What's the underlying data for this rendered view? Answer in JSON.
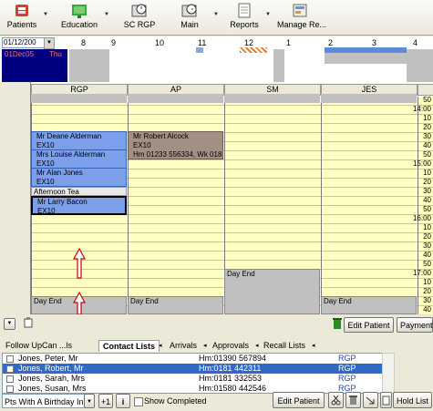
{
  "toolbar": {
    "patients": "Patients",
    "education": "Education",
    "sc_rgp": "SC RGP",
    "main": "Main",
    "reports": "Reports",
    "manage": "Manage Re..."
  },
  "strip": {
    "date": "01/12/200",
    "day_date": "01Dec05",
    "day_name": "Thu",
    "hours": [
      "8",
      "9",
      "10",
      "11",
      "12",
      "1",
      "2",
      "3",
      "4"
    ]
  },
  "schedule": {
    "times": [
      "50",
      "14:00",
      "10",
      "20",
      "30",
      "40",
      "50",
      "15:00",
      "10",
      "20",
      "30",
      "40",
      "50",
      "16:00",
      "10",
      "20",
      "30",
      "40",
      "50",
      "17:00",
      "10",
      "20",
      "30",
      "40"
    ],
    "columns": [
      "RGP",
      "AP",
      "SM",
      "JES"
    ],
    "appointments": {
      "a1_name": "Mr Deane Alderman",
      "a1_code": "EX10",
      "a2_name": "Mrs Louise Alderman",
      "a2_code": "EX10",
      "a3_name": "Mr Alan Jones",
      "a3_code": "EX10",
      "tea": "Afternoon Tea",
      "a4_name": "Mr Larry Bacon",
      "a4_code": "EX10",
      "b1_name": "Mr Robert Alcock",
      "b1_code": "EX10",
      "b1_phone": "Hm 01233 556334, Wk 018",
      "day_end": "Day End"
    }
  },
  "bottom": {
    "edit_patient": "Edit Patient",
    "payment": "Payment",
    "tabs": [
      "Follow Up",
      "Can ...ls",
      "Contact Lists",
      "Arrivals",
      "Approvals",
      "Recall Lists"
    ],
    "rows": [
      {
        "name": "Jones, Peter, Mr",
        "phone": "Hm:01390 567894",
        "dr": "RGP"
      },
      {
        "name": "Jones, Robert, Mr",
        "phone": "Hm:0181 442311",
        "dr": "RGP"
      },
      {
        "name": "Jones, Sarah, Mrs",
        "phone": "Hm:0181 332553",
        "dr": "RGP"
      },
      {
        "name": "Jones, Susan, Mrs",
        "phone": "Hm:01580 442546",
        "dr": "RGP"
      }
    ],
    "filter": "Pts With A Birthday In",
    "plus_one": "+1",
    "info": "i",
    "show_completed": "Show Completed",
    "edit_patient_2": "Edit Patient",
    "hold_list": "Hold List"
  },
  "colors": {
    "appointment_blue": "#7b9fe9",
    "appointment_brown": "#a39084",
    "grid_yellow": "#ffffc4",
    "selection_blue": "#3169c6"
  }
}
